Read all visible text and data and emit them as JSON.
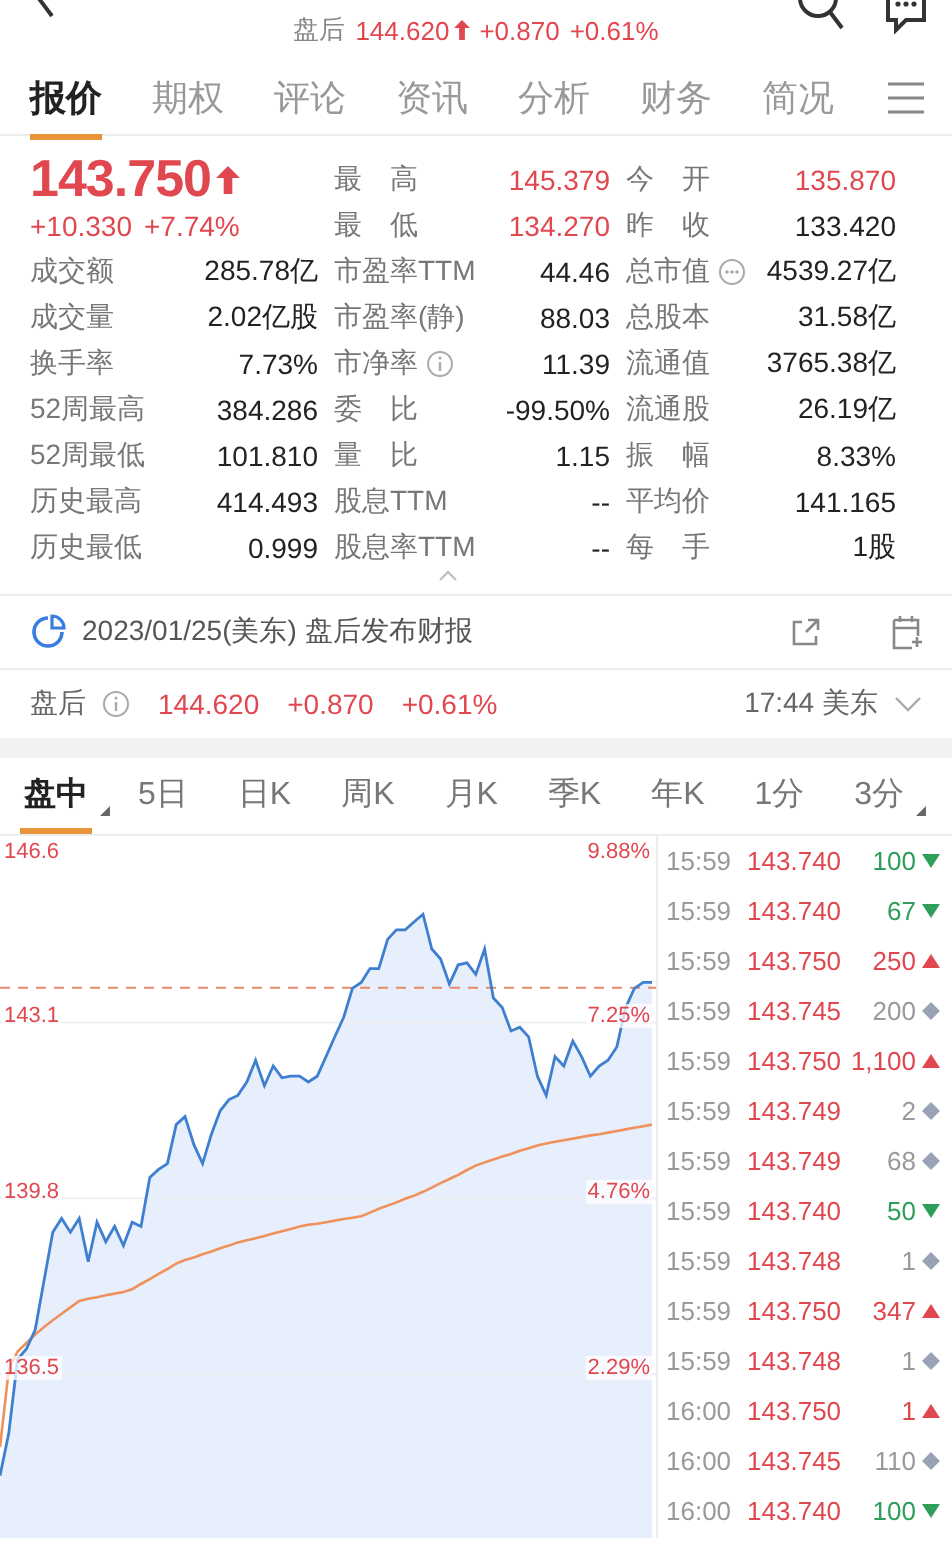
{
  "header": {
    "session": "盘后",
    "price": "144.620",
    "change": "+0.870",
    "change_pct": "+0.61%"
  },
  "tabs": [
    {
      "label": "报价",
      "selected": true
    },
    {
      "label": "期权",
      "selected": false
    },
    {
      "label": "评论",
      "selected": false
    },
    {
      "label": "资讯",
      "selected": false
    },
    {
      "label": "分析",
      "selected": false
    },
    {
      "label": "财务",
      "selected": false
    },
    {
      "label": "简况",
      "selected": false
    }
  ],
  "quote": {
    "price": "143.750",
    "change": "+10.330",
    "change_pct": "+7.74%",
    "top_rows": [
      [
        {
          "label": "最　高",
          "value": "145.379",
          "rising": true
        },
        {
          "label": "今　开",
          "value": "135.870",
          "rising": true
        }
      ],
      [
        {
          "label": "最　低",
          "value": "134.270",
          "rising": true
        },
        {
          "label": "昨　收",
          "value": "133.420",
          "rising": false
        }
      ]
    ],
    "rows": [
      [
        {
          "label": "成交额",
          "value": "285.78亿",
          "rising": false,
          "kind": "plain"
        },
        {
          "label": "市盈率TTM",
          "value": "44.46",
          "rising": false,
          "kind": "plain"
        },
        {
          "label": "总市值",
          "value": "4539.27亿",
          "rising": false,
          "kind": "more"
        }
      ],
      [
        {
          "label": "成交量",
          "value": "2.02亿股",
          "rising": false,
          "kind": "plain"
        },
        {
          "label": "市盈率(静)",
          "value": "88.03",
          "rising": false,
          "kind": "plain"
        },
        {
          "label": "总股本",
          "value": "31.58亿",
          "rising": false,
          "kind": "plain"
        }
      ],
      [
        {
          "label": "换手率",
          "value": "7.73%",
          "rising": false,
          "kind": "plain"
        },
        {
          "label": "市净率",
          "value": "11.39",
          "rising": false,
          "kind": "info"
        },
        {
          "label": "流通值",
          "value": "3765.38亿",
          "rising": false,
          "kind": "plain"
        }
      ],
      [
        {
          "label": "52周最高",
          "value": "384.286",
          "rising": false,
          "kind": "plain"
        },
        {
          "label": "委　比",
          "value": "-99.50%",
          "rising": false,
          "kind": "plain"
        },
        {
          "label": "流通股",
          "value": "26.19亿",
          "rising": false,
          "kind": "plain"
        }
      ],
      [
        {
          "label": "52周最低",
          "value": "101.810",
          "rising": false,
          "kind": "plain"
        },
        {
          "label": "量　比",
          "value": "1.15",
          "rising": false,
          "kind": "plain"
        },
        {
          "label": "振　幅",
          "value": "8.33%",
          "rising": false,
          "kind": "plain"
        }
      ],
      [
        {
          "label": "历史最高",
          "value": "414.493",
          "rising": false,
          "kind": "plain"
        },
        {
          "label": "股息TTM",
          "value": "--",
          "rising": false,
          "kind": "plain"
        },
        {
          "label": "平均价",
          "value": "141.165",
          "rising": false,
          "kind": "plain"
        }
      ],
      [
        {
          "label": "历史最低",
          "value": "0.999",
          "rising": false,
          "kind": "plain"
        },
        {
          "label": "股息率TTM",
          "value": "--",
          "rising": false,
          "kind": "plain"
        },
        {
          "label": "每　手",
          "value": "1股",
          "rising": false,
          "kind": "plain"
        }
      ]
    ]
  },
  "event": {
    "text": "2023/01/25(美东) 盘后发布财报"
  },
  "after_hours": {
    "label": "盘后",
    "price": "144.620",
    "change": "+0.870",
    "change_pct": "+0.61%",
    "time": "17:44 美东"
  },
  "chart_tabs": [
    {
      "label": "盘中",
      "selected": true,
      "corner": true
    },
    {
      "label": "5日",
      "selected": false,
      "corner": false
    },
    {
      "label": "日K",
      "selected": false,
      "corner": false
    },
    {
      "label": "周K",
      "selected": false,
      "corner": false
    },
    {
      "label": "月K",
      "selected": false,
      "corner": false
    },
    {
      "label": "季K",
      "selected": false,
      "corner": false
    },
    {
      "label": "年K",
      "selected": false,
      "corner": false
    },
    {
      "label": "1分",
      "selected": false,
      "corner": false
    },
    {
      "label": "3分",
      "selected": false,
      "corner": true
    }
  ],
  "chart": {
    "pct_labels": [
      "9.88%",
      "7.25%",
      "4.76%",
      "2.29%"
    ],
    "chart_data": {
      "type": "area",
      "ylim": [
        133.42,
        146.6
      ],
      "grid": true,
      "ref_lines": [
        {
          "axis": "y",
          "value": 143.75
        }
      ],
      "yticks": [
        {
          "value": 146.6,
          "label": "146.6"
        },
        {
          "value": 143.1,
          "label": "143.1"
        },
        {
          "value": 139.8,
          "label": "139.8"
        },
        {
          "value": 136.5,
          "label": "136.5"
        }
      ],
      "series": [
        {
          "color": "#3f7fd0",
          "values": [
            134.59,
            135.39,
            136.78,
            136.97,
            137.33,
            138.25,
            139.16,
            139.42,
            139.16,
            139.42,
            138.61,
            139.35,
            138.98,
            139.27,
            138.91,
            139.35,
            139.27,
            140.19,
            140.34,
            140.45,
            141.18,
            141.33,
            140.81,
            140.45,
            141.0,
            141.44,
            141.65,
            141.73,
            141.98,
            142.39,
            141.91,
            142.28,
            142.06,
            142.09,
            142.09,
            141.98,
            142.09,
            142.46,
            142.83,
            143.19,
            143.74,
            143.85,
            144.11,
            144.11,
            144.66,
            144.84,
            144.84,
            144.99,
            145.13,
            144.48,
            144.29,
            143.82,
            144.18,
            144.22,
            144.0,
            144.48,
            143.56,
            143.38,
            142.94,
            143.01,
            142.83,
            142.09,
            141.73,
            142.46,
            142.28,
            142.75,
            142.46,
            142.09,
            142.28,
            142.39,
            142.64,
            143.38,
            143.74,
            143.85,
            143.85
          ]
        },
        {
          "type": "line",
          "color": "#f0905a",
          "values": [
            135.13,
            136.58,
            136.92,
            137.08,
            137.24,
            137.38,
            137.51,
            137.63,
            137.75,
            137.87,
            137.91,
            137.94,
            137.98,
            138.01,
            138.04,
            138.09,
            138.19,
            138.28,
            138.38,
            138.47,
            138.57,
            138.64,
            138.69,
            138.75,
            138.8,
            138.86,
            138.91,
            138.97,
            139.01,
            139.05,
            139.09,
            139.14,
            139.18,
            139.22,
            139.27,
            139.3,
            139.32,
            139.35,
            139.38,
            139.41,
            139.43,
            139.46,
            139.53,
            139.6,
            139.66,
            139.72,
            139.79,
            139.85,
            139.92,
            140.0,
            140.08,
            140.16,
            140.24,
            140.33,
            140.41,
            140.47,
            140.53,
            140.58,
            140.63,
            140.69,
            140.74,
            140.79,
            140.83,
            140.86,
            140.89,
            140.92,
            140.95,
            140.98,
            141.0,
            141.03,
            141.06,
            141.09,
            141.12,
            141.15,
            141.18
          ]
        }
      ]
    }
  },
  "ticks": [
    {
      "time": "15:59",
      "price": "143.740",
      "volume": "100",
      "kind": "down"
    },
    {
      "time": "15:59",
      "price": "143.740",
      "volume": "67",
      "kind": "down"
    },
    {
      "time": "15:59",
      "price": "143.750",
      "volume": "250",
      "kind": "up"
    },
    {
      "time": "15:59",
      "price": "143.745",
      "volume": "200",
      "kind": "neutral"
    },
    {
      "time": "15:59",
      "price": "143.750",
      "volume": "1,100",
      "kind": "up"
    },
    {
      "time": "15:59",
      "price": "143.749",
      "volume": "2",
      "kind": "neutral"
    },
    {
      "time": "15:59",
      "price": "143.749",
      "volume": "68",
      "kind": "neutral"
    },
    {
      "time": "15:59",
      "price": "143.740",
      "volume": "50",
      "kind": "down"
    },
    {
      "time": "15:59",
      "price": "143.748",
      "volume": "1",
      "kind": "neutral"
    },
    {
      "time": "15:59",
      "price": "143.750",
      "volume": "347",
      "kind": "up"
    },
    {
      "time": "15:59",
      "price": "143.748",
      "volume": "1",
      "kind": "neutral"
    },
    {
      "time": "16:00",
      "price": "143.750",
      "volume": "1",
      "kind": "up"
    },
    {
      "time": "16:00",
      "price": "143.745",
      "volume": "110",
      "kind": "neutral"
    },
    {
      "time": "16:00",
      "price": "143.740",
      "volume": "100",
      "kind": "down"
    }
  ]
}
